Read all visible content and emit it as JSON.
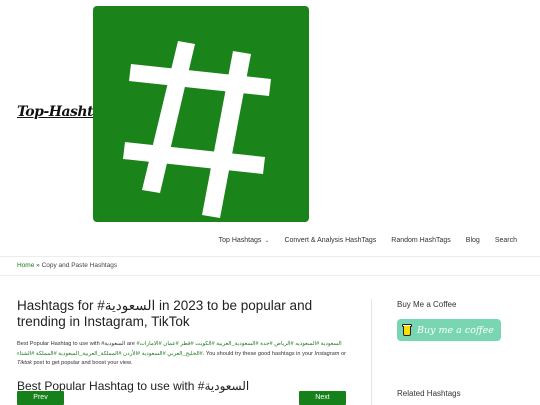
{
  "site": {
    "title": "Top-Hashtags"
  },
  "logo": {
    "symbol": "#",
    "color": "#1a841a"
  },
  "nav": {
    "items": [
      {
        "label": "Top Hashtags",
        "has_dropdown": true
      },
      {
        "label": "Convert & Analysis HashTags"
      },
      {
        "label": "Random HashTags"
      },
      {
        "label": "Blog"
      },
      {
        "label": "Search"
      }
    ]
  },
  "breadcrumb": {
    "home": "Home",
    "separator": " » ",
    "current": "Copy and Paste Hashtags"
  },
  "article": {
    "title": "Hashtags for #السعودية in 2023 to be popular and trending in Instagram, TikTok",
    "intro_prefix": "Best Popular Hashtag to use with #السعودية are",
    "intro_tags": "#السعودية #السعوديه #الرياض #جدة #السعودية_العربية #الكويت #قطر #عمان #الامارات #الخليج_العربي #السعودية #الأردن #المملكة_العربية_السعودية #المملكة #الشتاء",
    "intro_suffix_1": ". You should try these good hashtags in your",
    "intro_instagram": "Instagram",
    "intro_or": "or",
    "intro_tiktok": "Tiktok",
    "intro_suffix_2": "post to get popular and boost your view.",
    "section_title": "Best Popular Hashtag to use with #السعودية",
    "prev_label": "Prev",
    "next_label": "Next"
  },
  "sidebar": {
    "coffee_title": "Buy Me a Coffee",
    "coffee_button": "Buy me a coffee",
    "related_title": "Related Hashtags"
  },
  "colors": {
    "accent": "#16801a",
    "coffee_button": "#79d6b3"
  }
}
